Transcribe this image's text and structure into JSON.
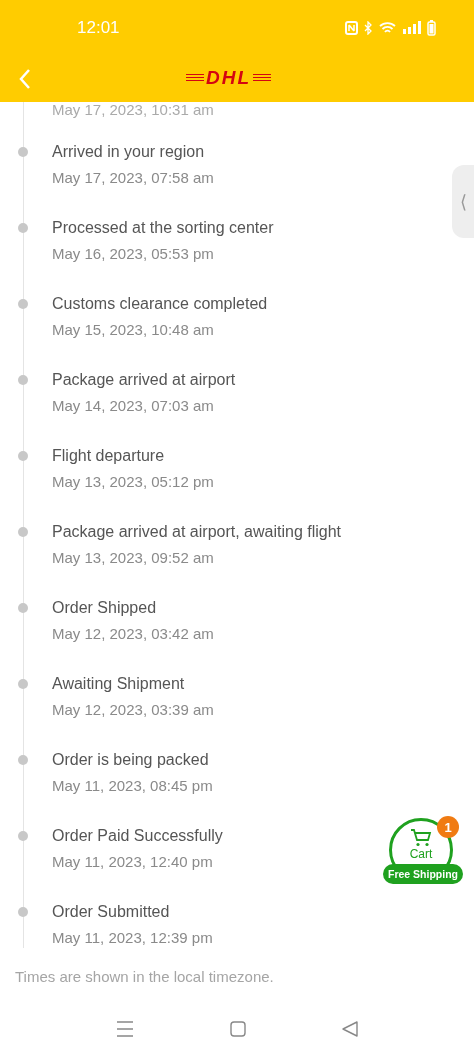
{
  "status_bar": {
    "time": "12:01"
  },
  "header": {
    "logo": "DHL"
  },
  "partial_time": "May 17, 2023, 10:31 am",
  "events": [
    {
      "title": "Arrived in your region",
      "time": "May 17, 2023, 07:58 am"
    },
    {
      "title": "Processed at the sorting center",
      "time": "May 16, 2023, 05:53 pm"
    },
    {
      "title": "Customs clearance completed",
      "time": "May 15, 2023, 10:48 am"
    },
    {
      "title": "Package arrived at airport",
      "time": "May 14, 2023, 07:03 am"
    },
    {
      "title": "Flight departure",
      "time": "May 13, 2023, 05:12 pm"
    },
    {
      "title": "Package arrived at airport, awaiting flight",
      "time": "May 13, 2023, 09:52 am"
    },
    {
      "title": "Order Shipped",
      "time": "May 12, 2023, 03:42 am"
    },
    {
      "title": "Awaiting Shipment",
      "time": "May 12, 2023, 03:39 am"
    },
    {
      "title": "Order is being packed",
      "time": "May 11, 2023, 08:45 pm"
    },
    {
      "title": "Order Paid Successfully",
      "time": "May 11, 2023, 12:40 pm"
    },
    {
      "title": "Order Submitted",
      "time": "May 11, 2023, 12:39 pm"
    }
  ],
  "footer_note": "Times are shown in the local timezone.",
  "side_tab": {
    "glyph": "⟨"
  },
  "cart": {
    "label": "Cart",
    "count": "1",
    "badge": "Free Shipping"
  }
}
